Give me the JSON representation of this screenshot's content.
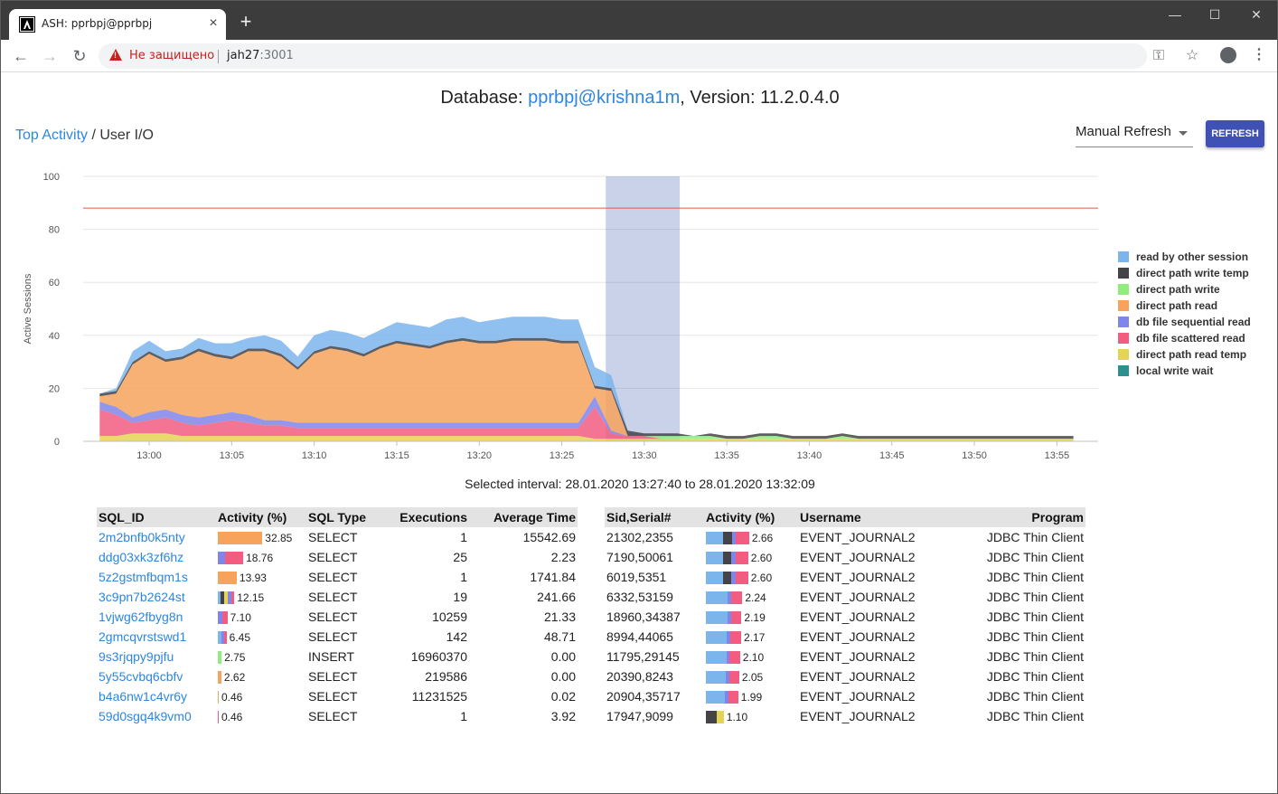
{
  "browser": {
    "tab_title": "ASH: pprbpj@pprbpj",
    "security_text": "Не защищено",
    "url_host": "jah27",
    "url_port": ":3001"
  },
  "header": {
    "prefix": "Database: ",
    "db_name": "pprbpj@krishna1m",
    "suffix": ", Version: 11.2.0.4.0"
  },
  "breadcrumb": {
    "link": "Top Activity",
    "separator": " / ",
    "current": "User I/O"
  },
  "controls": {
    "refresh_mode": "Manual Refresh",
    "refresh_button": "REFRESH"
  },
  "chart_data": {
    "type": "area",
    "ylabel": "Active Sessions",
    "ylim": [
      0,
      100
    ],
    "yticks": [
      "0",
      "20",
      "40",
      "60",
      "80",
      "100"
    ],
    "xticks": [
      "13:00",
      "13:05",
      "13:10",
      "13:15",
      "13:20",
      "13:25",
      "13:30",
      "13:35",
      "13:40",
      "13:45",
      "13:50",
      "13:55"
    ],
    "threshold": 88,
    "selection": [
      "13:27:40",
      "13:32:09"
    ],
    "legend_placement": "right",
    "series": [
      {
        "name": "read by other session",
        "color": "#7cb5ec"
      },
      {
        "name": "direct path write temp",
        "color": "#434348"
      },
      {
        "name": "direct path write",
        "color": "#90ed7d"
      },
      {
        "name": "direct path read",
        "color": "#f7a35c"
      },
      {
        "name": "db file sequential read",
        "color": "#8085e9"
      },
      {
        "name": "db file scattered read",
        "color": "#f15c80"
      },
      {
        "name": "direct path read temp",
        "color": "#e4d354"
      },
      {
        "name": "local write wait",
        "color": "#2b908f"
      }
    ],
    "x_minutes": [
      -3,
      -2,
      -1,
      0,
      1,
      2,
      3,
      4,
      5,
      6,
      7,
      8,
      9,
      10,
      11,
      12,
      13,
      14,
      15,
      16,
      17,
      18,
      19,
      20,
      21,
      22,
      23,
      24,
      25,
      26,
      27,
      28,
      29,
      30,
      31,
      32,
      33,
      34,
      35,
      36,
      37,
      38,
      39,
      40,
      41,
      42,
      43,
      44,
      45,
      46,
      47,
      48,
      49,
      50,
      51,
      52,
      53,
      54,
      55,
      56
    ],
    "values": {
      "direct path read temp": [
        2,
        2,
        3,
        3,
        3,
        2,
        2,
        2,
        2,
        2,
        2,
        2,
        2,
        2,
        2,
        2,
        2,
        2,
        2,
        2,
        2,
        2,
        2,
        2,
        2,
        2,
        2,
        2,
        2,
        2,
        1,
        1,
        1,
        1,
        1,
        1,
        1,
        1,
        1,
        1,
        1,
        1,
        1,
        1,
        1,
        1,
        1,
        1,
        1,
        1,
        1,
        1,
        1,
        1,
        1,
        1,
        1,
        1,
        1,
        1
      ],
      "db file scattered read": [
        10,
        8,
        4,
        5,
        6,
        5,
        4,
        5,
        6,
        5,
        4,
        4,
        3,
        3,
        3,
        3,
        3,
        3,
        3,
        3,
        3,
        3,
        3,
        3,
        3,
        3,
        3,
        3,
        3,
        3,
        12,
        2,
        1,
        1,
        0,
        0,
        0,
        0,
        0,
        0,
        0,
        0,
        0,
        0,
        0,
        0,
        0,
        0,
        0,
        0,
        0,
        0,
        0,
        0,
        0,
        0,
        0,
        0,
        0,
        0
      ],
      "db file sequential read": [
        3,
        3,
        2,
        3,
        3,
        3,
        3,
        3,
        3,
        3,
        2,
        2,
        2,
        2,
        2,
        2,
        2,
        2,
        2,
        2,
        2,
        2,
        2,
        2,
        2,
        2,
        2,
        2,
        2,
        2,
        4,
        1,
        0,
        0,
        0,
        0,
        0,
        0,
        0,
        0,
        0,
        0,
        0,
        0,
        0,
        0,
        0,
        0,
        0,
        0,
        0,
        0,
        0,
        0,
        0,
        0,
        0,
        0,
        0,
        0
      ],
      "direct path read": [
        2,
        5,
        20,
        22,
        18,
        21,
        25,
        22,
        20,
        24,
        26,
        24,
        20,
        26,
        28,
        27,
        25,
        28,
        30,
        29,
        28,
        30,
        31,
        30,
        30,
        31,
        31,
        31,
        30,
        30,
        3,
        15,
        0,
        0,
        0,
        0,
        0,
        0,
        0,
        0,
        0,
        0,
        0,
        0,
        0,
        0,
        0,
        0,
        0,
        0,
        0,
        0,
        0,
        0,
        0,
        0,
        0,
        0,
        0,
        0
      ],
      "direct path write": [
        0,
        0,
        0,
        0,
        0,
        0,
        0,
        0,
        0,
        0,
        0,
        0,
        0,
        0,
        0,
        0,
        0,
        0,
        0,
        0,
        0,
        0,
        0,
        0,
        0,
        0,
        0,
        0,
        0,
        0,
        0,
        0,
        0,
        0,
        1,
        1,
        1,
        1,
        0,
        0,
        1,
        1,
        0,
        0,
        0,
        1,
        0,
        0,
        0,
        0,
        0,
        0,
        0,
        0,
        0,
        0,
        0,
        0,
        0,
        0
      ],
      "direct path write temp": [
        1,
        1,
        1,
        1,
        1,
        1,
        1,
        1,
        1,
        1,
        1,
        1,
        1,
        1,
        1,
        1,
        1,
        1,
        1,
        1,
        1,
        1,
        1,
        1,
        1,
        1,
        1,
        1,
        1,
        1,
        1,
        1,
        2,
        1,
        1,
        1,
        0,
        1,
        1,
        1,
        1,
        1,
        1,
        1,
        1,
        1,
        1,
        1,
        1,
        1,
        1,
        1,
        1,
        1,
        1,
        1,
        1,
        1,
        1,
        1
      ],
      "read by other session": [
        0,
        1,
        4,
        4,
        3,
        3,
        4,
        4,
        5,
        4,
        5,
        5,
        4,
        6,
        6,
        6,
        6,
        6,
        7,
        7,
        7,
        8,
        8,
        7,
        8,
        8,
        8,
        8,
        8,
        8,
        7,
        5,
        0,
        0,
        0,
        0,
        0,
        0,
        0,
        0,
        0,
        0,
        0,
        0,
        0,
        0,
        0,
        0,
        0,
        0,
        0,
        0,
        0,
        0,
        0,
        0,
        0,
        0,
        0,
        0
      ],
      "local write wait": [
        0,
        0,
        0,
        0,
        0,
        0,
        0,
        0,
        0,
        0,
        0,
        0,
        0,
        0,
        0,
        0,
        0,
        0,
        0,
        0,
        0,
        0,
        0,
        0,
        0,
        0,
        0,
        0,
        0,
        0,
        0,
        0,
        0,
        0,
        0,
        0,
        0,
        0,
        0,
        0,
        0,
        0,
        0,
        0,
        0,
        0,
        0,
        0,
        0,
        0,
        0,
        0,
        0,
        0,
        0,
        0,
        0,
        0,
        0,
        0
      ]
    }
  },
  "interval_text": "Selected interval: 28.01.2020 13:27:40 to 28.01.2020 13:32:09",
  "sql_table": {
    "headers": [
      "SQL_ID",
      "Activity (%)",
      "SQL Type",
      "Executions",
      "Average Time"
    ],
    "rows": [
      {
        "id": "2m2bnfb0k5nty",
        "activity": "32.85",
        "pct": 32.85,
        "segments": [
          [
            "#f7a35c",
            1
          ]
        ],
        "type": "SELECT",
        "executions": "1",
        "avg": "15542.69"
      },
      {
        "id": "ddg03xk3zf6hz",
        "activity": "18.76",
        "pct": 18.76,
        "segments": [
          [
            "#8085e9",
            0.3
          ],
          [
            "#f15c80",
            0.7
          ]
        ],
        "type": "SELECT",
        "executions": "25",
        "avg": "2.23"
      },
      {
        "id": "5z2gstmfbqm1s",
        "activity": "13.93",
        "pct": 13.93,
        "segments": [
          [
            "#f7a35c",
            1
          ]
        ],
        "type": "SELECT",
        "executions": "1",
        "avg": "1741.84"
      },
      {
        "id": "3c9pn7b2624st",
        "activity": "12.15",
        "pct": 12.15,
        "segments": [
          [
            "#7cb5ec",
            0.15
          ],
          [
            "#434348",
            0.25
          ],
          [
            "#e4d354",
            0.2
          ],
          [
            "#8085e9",
            0.2
          ],
          [
            "#f15c80",
            0.2
          ]
        ],
        "type": "SELECT",
        "executions": "19",
        "avg": "241.66"
      },
      {
        "id": "1vjwg62fbyg8n",
        "activity": "7.10",
        "pct": 7.1,
        "segments": [
          [
            "#8085e9",
            0.5
          ],
          [
            "#f15c80",
            0.5
          ]
        ],
        "type": "SELECT",
        "executions": "10259",
        "avg": "21.33"
      },
      {
        "id": "2gmcqvrstswd1",
        "activity": "6.45",
        "pct": 6.45,
        "segments": [
          [
            "#7cb5ec",
            0.4
          ],
          [
            "#8085e9",
            0.3
          ],
          [
            "#f15c80",
            0.3
          ]
        ],
        "type": "SELECT",
        "executions": "142",
        "avg": "48.71"
      },
      {
        "id": "9s3rjqpy9pjfu",
        "activity": "2.75",
        "pct": 2.75,
        "segments": [
          [
            "#90ed7d",
            1
          ]
        ],
        "type": "INSERT",
        "executions": "16960370",
        "avg": "0.00"
      },
      {
        "id": "5y55cvbq6cbfv",
        "activity": "2.62",
        "pct": 2.62,
        "segments": [
          [
            "#f7a35c",
            1
          ]
        ],
        "type": "SELECT",
        "executions": "219586",
        "avg": "0.00"
      },
      {
        "id": "b4a6nw1c4vr6y",
        "activity": "0.46",
        "pct": 0.46,
        "segments": [
          [
            "#f7a35c",
            1
          ]
        ],
        "type": "SELECT",
        "executions": "11231525",
        "avg": "0.02"
      },
      {
        "id": "59d0sgq4k9vm0",
        "activity": "0.46",
        "pct": 0.46,
        "segments": [
          [
            "#f15c80",
            1
          ]
        ],
        "type": "SELECT",
        "executions": "1",
        "avg": "3.92"
      }
    ]
  },
  "session_table": {
    "headers": [
      "Sid,Serial#",
      "Activity (%)",
      "Username",
      "Program"
    ],
    "rows": [
      {
        "sid": "21302,2355",
        "activity": "2.66",
        "pct": 2.66,
        "segments": [
          [
            "#7cb5ec",
            0.4
          ],
          [
            "#434348",
            0.2
          ],
          [
            "#8085e9",
            0.1
          ],
          [
            "#f15c80",
            0.3
          ]
        ],
        "user": "EVENT_JOURNAL2",
        "program": "JDBC Thin Client"
      },
      {
        "sid": "7190,50061",
        "activity": "2.60",
        "pct": 2.6,
        "segments": [
          [
            "#7cb5ec",
            0.4
          ],
          [
            "#434348",
            0.2
          ],
          [
            "#8085e9",
            0.1
          ],
          [
            "#f15c80",
            0.3
          ]
        ],
        "user": "EVENT_JOURNAL2",
        "program": "JDBC Thin Client"
      },
      {
        "sid": "6019,5351",
        "activity": "2.60",
        "pct": 2.6,
        "segments": [
          [
            "#7cb5ec",
            0.4
          ],
          [
            "#434348",
            0.2
          ],
          [
            "#8085e9",
            0.1
          ],
          [
            "#f15c80",
            0.3
          ]
        ],
        "user": "EVENT_JOURNAL2",
        "program": "JDBC Thin Client"
      },
      {
        "sid": "6332,53159",
        "activity": "2.24",
        "pct": 2.24,
        "segments": [
          [
            "#7cb5ec",
            0.6
          ],
          [
            "#8085e9",
            0.1
          ],
          [
            "#f15c80",
            0.3
          ]
        ],
        "user": "EVENT_JOURNAL2",
        "program": "JDBC Thin Client"
      },
      {
        "sid": "18960,34387",
        "activity": "2.19",
        "pct": 2.19,
        "segments": [
          [
            "#7cb5ec",
            0.6
          ],
          [
            "#8085e9",
            0.1
          ],
          [
            "#f15c80",
            0.3
          ]
        ],
        "user": "EVENT_JOURNAL2",
        "program": "JDBC Thin Client"
      },
      {
        "sid": "8994,44065",
        "activity": "2.17",
        "pct": 2.17,
        "segments": [
          [
            "#7cb5ec",
            0.6
          ],
          [
            "#8085e9",
            0.1
          ],
          [
            "#f15c80",
            0.3
          ]
        ],
        "user": "EVENT_JOURNAL2",
        "program": "JDBC Thin Client"
      },
      {
        "sid": "11795,29145",
        "activity": "2.10",
        "pct": 2.1,
        "segments": [
          [
            "#7cb5ec",
            0.6
          ],
          [
            "#8085e9",
            0.1
          ],
          [
            "#f15c80",
            0.3
          ]
        ],
        "user": "EVENT_JOURNAL2",
        "program": "JDBC Thin Client"
      },
      {
        "sid": "20390,8243",
        "activity": "2.05",
        "pct": 2.05,
        "segments": [
          [
            "#7cb5ec",
            0.6
          ],
          [
            "#8085e9",
            0.1
          ],
          [
            "#f15c80",
            0.3
          ]
        ],
        "user": "EVENT_JOURNAL2",
        "program": "JDBC Thin Client"
      },
      {
        "sid": "20904,35717",
        "activity": "1.99",
        "pct": 1.99,
        "segments": [
          [
            "#7cb5ec",
            0.6
          ],
          [
            "#8085e9",
            0.1
          ],
          [
            "#f15c80",
            0.3
          ]
        ],
        "user": "EVENT_JOURNAL2",
        "program": "JDBC Thin Client"
      },
      {
        "sid": "17947,9099",
        "activity": "1.10",
        "pct": 1.1,
        "segments": [
          [
            "#434348",
            0.6
          ],
          [
            "#e4d354",
            0.4
          ]
        ],
        "user": "EVENT_JOURNAL2",
        "program": "JDBC Thin Client"
      }
    ]
  }
}
